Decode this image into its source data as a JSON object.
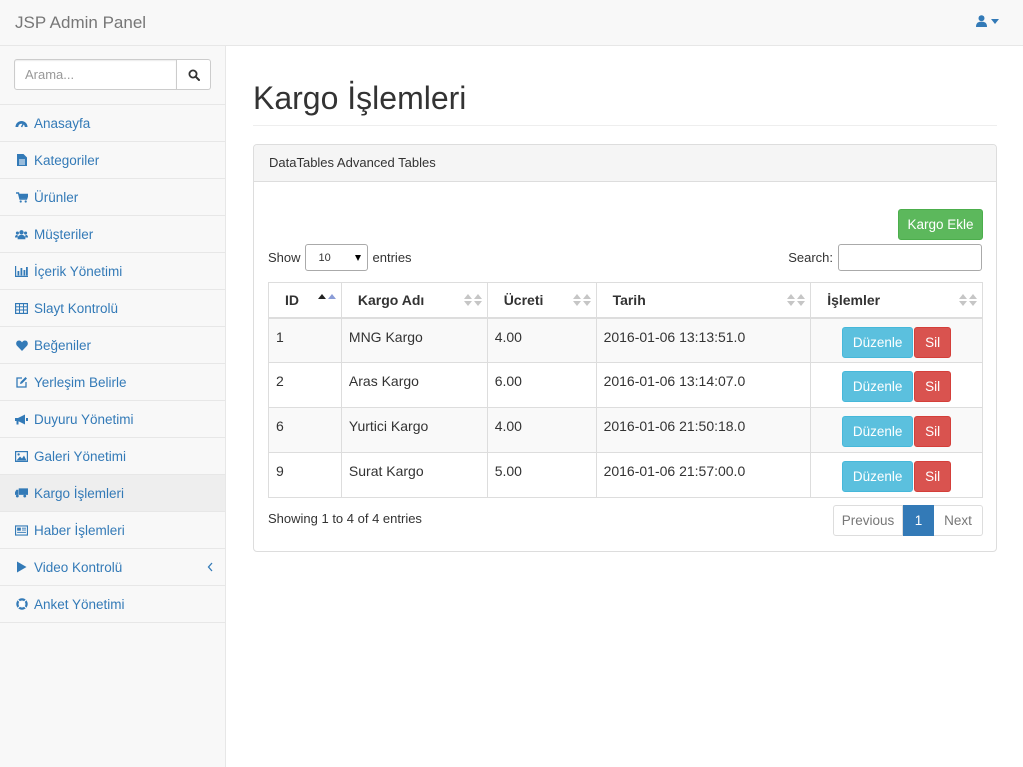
{
  "navbar": {
    "brand": "JSP Admin Panel",
    "user_icon": "user-icon"
  },
  "search": {
    "placeholder": "Arama...",
    "icon": "search-icon"
  },
  "sidebar": {
    "items": [
      {
        "label": "Anasayfa",
        "icon": "dashboard-icon"
      },
      {
        "label": "Kategoriler",
        "icon": "file-icon"
      },
      {
        "label": "Ürünler",
        "icon": "cart-icon"
      },
      {
        "label": "Müşteriler",
        "icon": "users-icon"
      },
      {
        "label": "İçerik Yönetimi",
        "icon": "bar-chart-icon"
      },
      {
        "label": "Slayt Kontrolü",
        "icon": "table-icon"
      },
      {
        "label": "Beğeniler",
        "icon": "heart-icon"
      },
      {
        "label": "Yerleşim Belirle",
        "icon": "edit-icon"
      },
      {
        "label": "Duyuru Yönetimi",
        "icon": "bullhorn-icon"
      },
      {
        "label": "Galeri Yönetimi",
        "icon": "image-icon"
      },
      {
        "label": "Kargo İşlemleri",
        "icon": "truck-icon",
        "active": true
      },
      {
        "label": "Haber İşlemleri",
        "icon": "newspaper-icon"
      },
      {
        "label": "Video Kontrolü",
        "icon": "play-icon",
        "has_submenu": true
      },
      {
        "label": "Anket Yönetimi",
        "icon": "life-ring-icon"
      }
    ]
  },
  "page": {
    "title": "Kargo İşlemleri"
  },
  "panel": {
    "heading": "DataTables Advanced Tables",
    "add_button": "Kargo Ekle",
    "length": {
      "show": "Show",
      "value": "10",
      "entries": "entries"
    },
    "filter": {
      "label": "Search:"
    },
    "table": {
      "columns": [
        "ID",
        "Kargo Adı",
        "Ücreti",
        "Tarih",
        "İşlemler"
      ],
      "sorted_column": "ID",
      "sort_direction": "ascending",
      "rows": [
        {
          "id": "1",
          "name": "MNG Kargo",
          "fee": "4.00",
          "date": "2016-01-06 13:13:51.0"
        },
        {
          "id": "2",
          "name": "Aras Kargo",
          "fee": "6.00",
          "date": "2016-01-06 13:14:07.0"
        },
        {
          "id": "6",
          "name": "Yurtici Kargo",
          "fee": "4.00",
          "date": "2016-01-06 21:50:18.0"
        },
        {
          "id": "9",
          "name": "Surat Kargo",
          "fee": "5.00",
          "date": "2016-01-06 21:57:00.0"
        }
      ],
      "edit_label": "Düzenle",
      "delete_label": "Sil"
    },
    "info": "Showing 1 to 4 of 4 entries",
    "pagination": {
      "previous": "Previous",
      "current": "1",
      "next": "Next"
    }
  },
  "colors": {
    "link": "#337ab7",
    "success": "#5cb85c",
    "info": "#5bc0de",
    "danger": "#d9534f",
    "navbar_bg": "#f8f8f8"
  }
}
